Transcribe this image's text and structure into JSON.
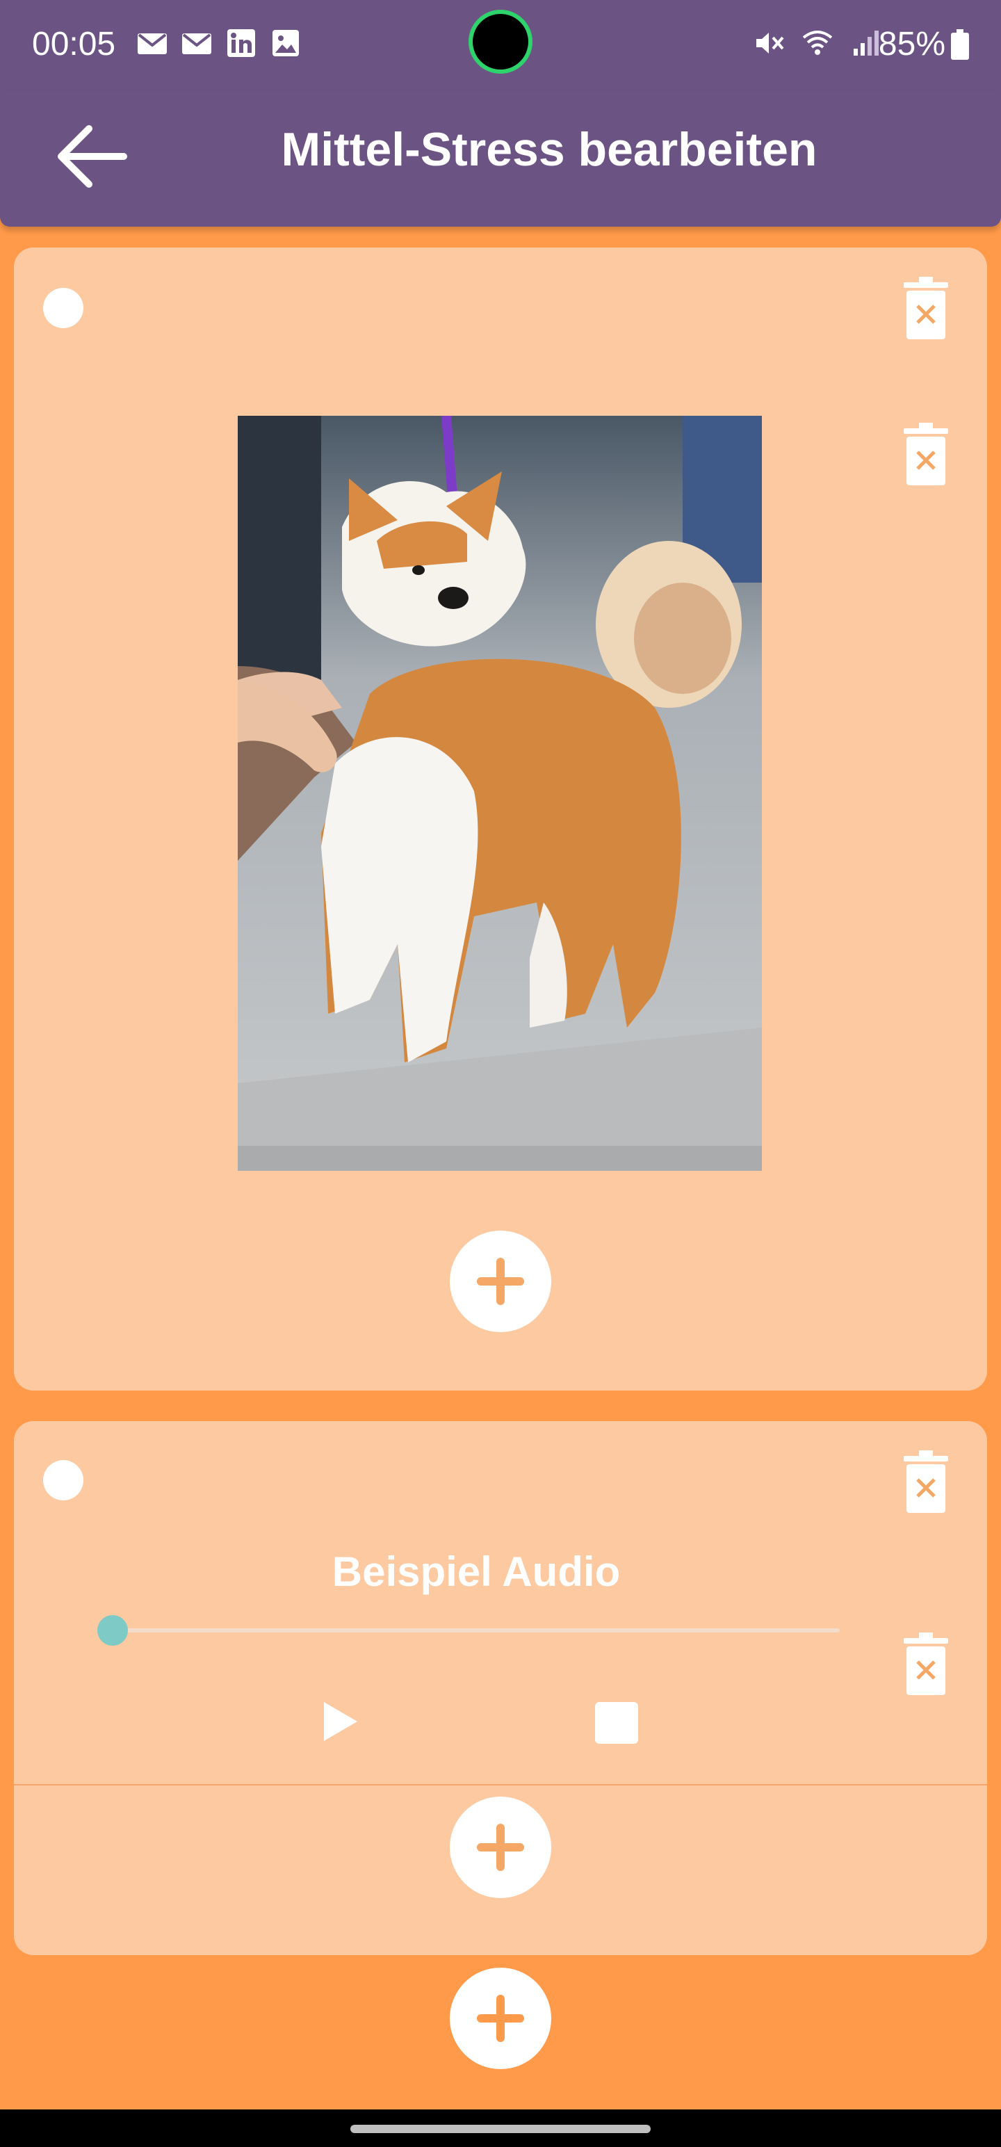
{
  "status_bar": {
    "time": "00:05",
    "battery": "85%",
    "left_icons": [
      "mail-icon",
      "mail-icon",
      "linkedin-icon",
      "gallery-icon"
    ],
    "right_icons": [
      "mute-icon",
      "wifi-icon",
      "signal-icon"
    ]
  },
  "app_bar": {
    "title": "Mittel-Stress bearbeiten",
    "back_icon": "arrow-left-icon",
    "color": "#6B5383"
  },
  "cards": [
    {
      "type": "image",
      "image_description_icon": "dog-photo",
      "delete_icons": [
        "trash-icon",
        "trash-icon"
      ],
      "add_icon": "plus-icon"
    },
    {
      "type": "audio",
      "title": "Beispiel Audio",
      "progress": 0.0,
      "delete_icons": [
        "trash-icon",
        "trash-icon"
      ],
      "controls": [
        "play-icon",
        "stop-icon"
      ],
      "add_icon": "plus-icon"
    }
  ],
  "colors": {
    "background": "#FF9A4A",
    "card": "#FDC9A1",
    "accent": "#F5A765",
    "slider_thumb": "#7DCAC6"
  }
}
